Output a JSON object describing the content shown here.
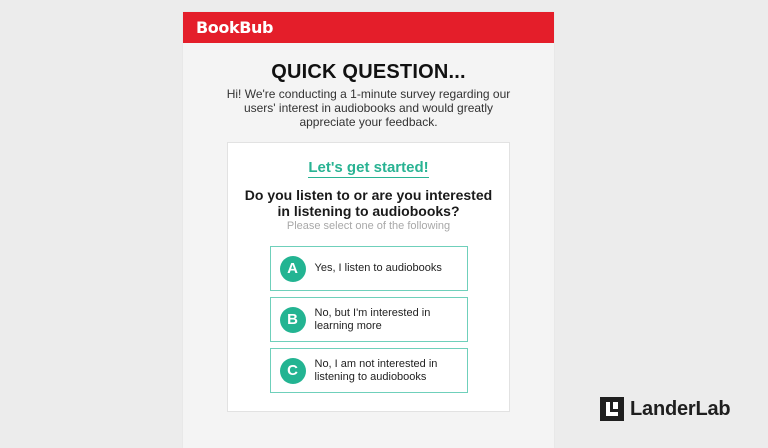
{
  "brand": "BookBub",
  "heading": "QUICK QUESTION...",
  "intro": "Hi! We're conducting a 1-minute survey regarding our users' interest in audiobooks and would greatly appreciate your feedback.",
  "card": {
    "start": "Let's get started!",
    "question": "Do you listen to or are you interested in listening to audiobooks?",
    "hint": "Please select one of the following",
    "options": [
      {
        "letter": "A",
        "text": "Yes, I listen to audiobooks"
      },
      {
        "letter": "B",
        "text": "No, but I'm interested in learning more"
      },
      {
        "letter": "C",
        "text": "No, I am not interested in listening to audiobooks"
      }
    ]
  },
  "logo": "LanderLab",
  "colors": {
    "brand_red": "#e41e2a",
    "accent_teal": "#23b492"
  }
}
